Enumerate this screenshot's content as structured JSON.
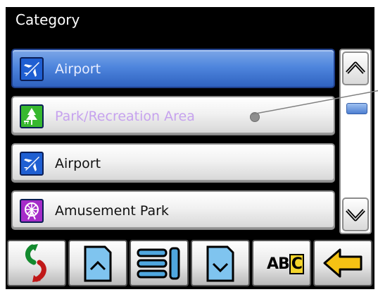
{
  "header": {
    "title": "Category"
  },
  "list": {
    "items": [
      {
        "label": "Airport",
        "icon": "airplane-icon",
        "state": "selected"
      },
      {
        "label": "Park/Recreation Area",
        "icon": "tree-icon",
        "state": "faded"
      },
      {
        "label": "Airport",
        "icon": "airplane-icon",
        "state": "normal"
      },
      {
        "label": "Amusement Park",
        "icon": "ferris-wheel-icon",
        "state": "normal"
      }
    ]
  },
  "scrollbar": {
    "up_icon": "chevron-up-icon",
    "down_icon": "chevron-down-icon"
  },
  "toolbar": {
    "buttons": [
      "rotate-icon",
      "page-up-icon",
      "list-icon",
      "page-down-icon",
      "abc-icon",
      "back-arrow-icon"
    ],
    "abc_text_ab": "AB",
    "abc_text_c": "C"
  },
  "colors": {
    "selected": "#4f86dd",
    "faded_text": "#c6a2ee",
    "accent_yellow": "#f4d52c"
  }
}
